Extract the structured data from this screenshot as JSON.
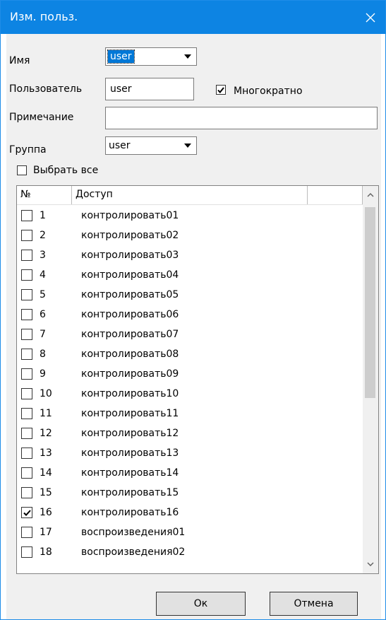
{
  "window": {
    "title": "Изм. польз."
  },
  "form": {
    "name_label": "Имя",
    "name_value": "user",
    "user_label": "Пользователь",
    "user_value": "user",
    "multi_label": "Многократно",
    "multi_checked": true,
    "note_label": "Примечание",
    "note_value": "",
    "group_label": "Группа",
    "group_value": "user",
    "select_all_label": "Выбрать все",
    "select_all_checked": false
  },
  "list": {
    "col_num": "№",
    "col_access": "Доступ",
    "rows": [
      {
        "num": "1",
        "access": "контролировать01",
        "checked": false
      },
      {
        "num": "2",
        "access": "контролировать02",
        "checked": false
      },
      {
        "num": "3",
        "access": "контролировать03",
        "checked": false
      },
      {
        "num": "4",
        "access": "контролировать04",
        "checked": false
      },
      {
        "num": "5",
        "access": "контролировать05",
        "checked": false
      },
      {
        "num": "6",
        "access": "контролировать06",
        "checked": false
      },
      {
        "num": "7",
        "access": "контролировать07",
        "checked": false
      },
      {
        "num": "8",
        "access": "контролировать08",
        "checked": false
      },
      {
        "num": "9",
        "access": "контролировать09",
        "checked": false
      },
      {
        "num": "10",
        "access": "контролировать10",
        "checked": false
      },
      {
        "num": "11",
        "access": "контролировать11",
        "checked": false
      },
      {
        "num": "12",
        "access": "контролировать12",
        "checked": false
      },
      {
        "num": "13",
        "access": "контролировать13",
        "checked": false
      },
      {
        "num": "14",
        "access": "контролировать14",
        "checked": false
      },
      {
        "num": "15",
        "access": "контролировать15",
        "checked": false
      },
      {
        "num": "16",
        "access": "контролировать16",
        "checked": true
      },
      {
        "num": "17",
        "access": "воспроизведения01",
        "checked": false
      },
      {
        "num": "18",
        "access": "воспроизведения02",
        "checked": false
      }
    ]
  },
  "buttons": {
    "ok": "Ок",
    "cancel": "Отмена"
  },
  "colors": {
    "titlebar": "#0d84e3",
    "frame": "#f0f0f0",
    "selection": "#0078d7"
  }
}
